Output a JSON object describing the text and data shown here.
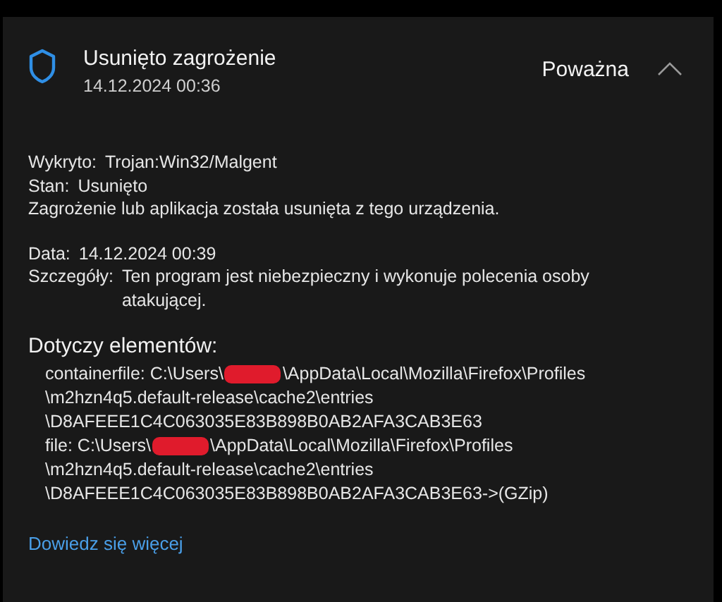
{
  "header": {
    "title": "Usunięto zagrożenie",
    "date": "14.12.2024 00:36",
    "severity": "Poważna",
    "expanded": true
  },
  "status": [
    {
      "label": "Wykryto:",
      "value": "Trojan:Win32/Malgent"
    },
    {
      "label": "Stan:",
      "value": "Usunięto"
    }
  ],
  "message": "Zagrożenie lub aplikacja została usunięta z tego urządzenia.",
  "details": [
    {
      "label": "Data:",
      "value": "14.12.2024 00:39"
    },
    {
      "label": "Szczegóły:",
      "value": "Ten program jest niebezpieczny i wykonuje polecenia osoby atakującej."
    }
  ],
  "affected": {
    "title": "Dotyczy elementów:",
    "items": [
      {
        "prefix": "containerfile: C:\\Users\\",
        "suffix": "\\AppData\\Local\\Mozilla\\Firefox\\Profiles",
        "lines": [
          "\\m2hzn4q5.default-release\\cache2\\entries",
          "\\D8AFEEE1C4C063035E83B898B0AB2AFA3CAB3E63"
        ]
      },
      {
        "prefix": "file: C:\\Users\\",
        "suffix": "\\AppData\\Local\\Mozilla\\Firefox\\Profiles",
        "lines": [
          "\\m2hzn4q5.default-release\\cache2\\entries",
          "\\D8AFEEE1C4C063035E83B898B0AB2AFA3CAB3E63->(GZip)"
        ]
      }
    ]
  },
  "link": "Dowiedz się więcej"
}
